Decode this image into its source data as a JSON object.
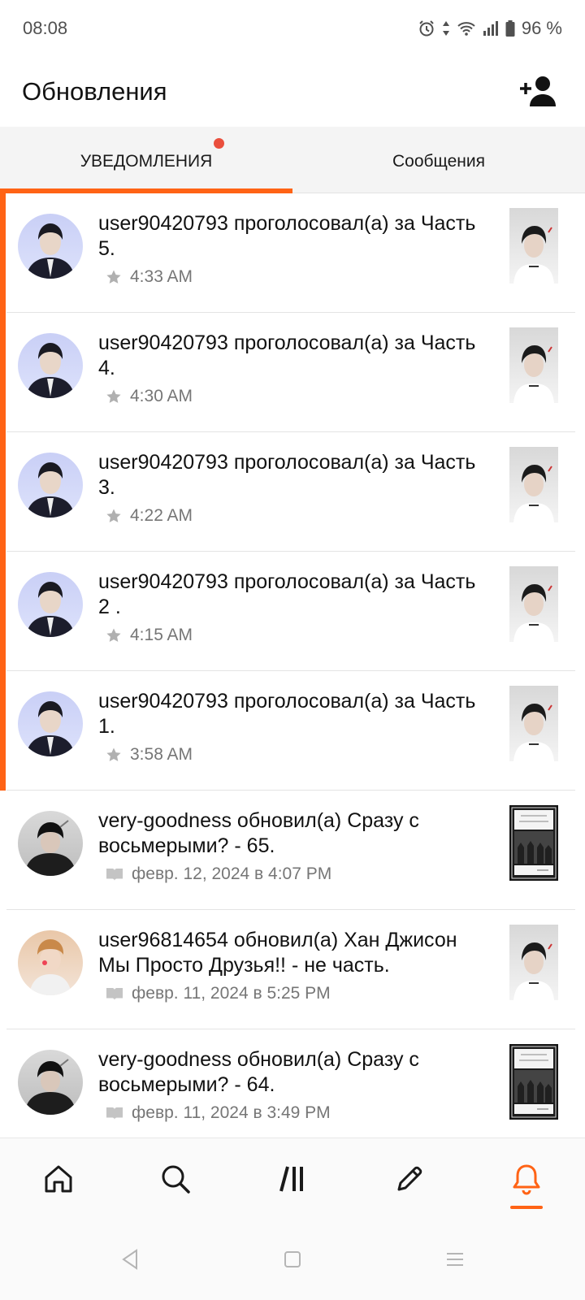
{
  "status_bar": {
    "time": "08:08",
    "battery": "96 %",
    "icons": [
      "alarm-icon",
      "data-arrows-icon",
      "wifi-icon",
      "signal-icon",
      "battery-icon"
    ]
  },
  "header": {
    "title": "Обновления",
    "action_icon": "add-friend-icon"
  },
  "tabs": [
    {
      "label": "УВЕДОМЛЕНИЯ",
      "active": true,
      "has_badge": true
    },
    {
      "label": "Сообщения",
      "active": false,
      "has_badge": false
    }
  ],
  "colors": {
    "accent": "#ff6315",
    "badge": "#ea4f3d",
    "meta_text": "#767676"
  },
  "notifications": [
    {
      "user": "user90420793",
      "action": " проголосовал(а) за ",
      "target": "Часть 5",
      "suffix": ".",
      "meta": "4:33 AM",
      "meta_icon": "star-icon",
      "unread": true
    },
    {
      "user": "user90420793",
      "action": " проголосовал(а) за ",
      "target": "Часть 4",
      "suffix": ".",
      "meta": "4:30 AM",
      "meta_icon": "star-icon",
      "unread": true
    },
    {
      "user": "user90420793",
      "action": " проголосовал(а) за ",
      "target": "Часть 3",
      "suffix": ".",
      "meta": "4:22 AM",
      "meta_icon": "star-icon",
      "unread": true
    },
    {
      "user": "user90420793",
      "action": " проголосовал(а) за ",
      "target": "Часть 2 ",
      "suffix": ".",
      "meta": "4:15 AM",
      "meta_icon": "star-icon",
      "unread": true
    },
    {
      "user": "user90420793",
      "action": " проголосовал(а) за ",
      "target": "Часть 1",
      "suffix": ".",
      "meta": "3:58 AM",
      "meta_icon": "star-icon",
      "unread": true
    },
    {
      "user": "very-goodness",
      "action": " обновил(а) ",
      "target": "Сразу с восьмерыми? - 65",
      "suffix": ".",
      "meta": "февр. 12, 2024 в 4:07 PM",
      "meta_icon": "book-icon",
      "unread": false
    },
    {
      "user": "user96814654",
      "action": " обновил(а) ",
      "target": "Хан Джисон Мы Просто Друзья!! - не часть",
      "suffix": ".",
      "meta": "февр. 11, 2024 в 5:25 PM",
      "meta_icon": "book-icon",
      "unread": false
    },
    {
      "user": "very-goodness",
      "action": " обновил(а) ",
      "target": "Сразу с восьмерыми? - 64",
      "suffix": ".",
      "meta": "февр. 11, 2024 в 3:49 PM",
      "meta_icon": "book-icon",
      "unread": false
    }
  ],
  "bottom_nav": [
    {
      "icon": "home-icon",
      "active": false
    },
    {
      "icon": "search-icon",
      "active": false
    },
    {
      "icon": "library-icon",
      "active": false
    },
    {
      "icon": "write-icon",
      "active": false
    },
    {
      "icon": "bell-icon",
      "active": true
    }
  ],
  "system_nav": [
    "back-icon",
    "home-square-icon",
    "recents-icon"
  ]
}
